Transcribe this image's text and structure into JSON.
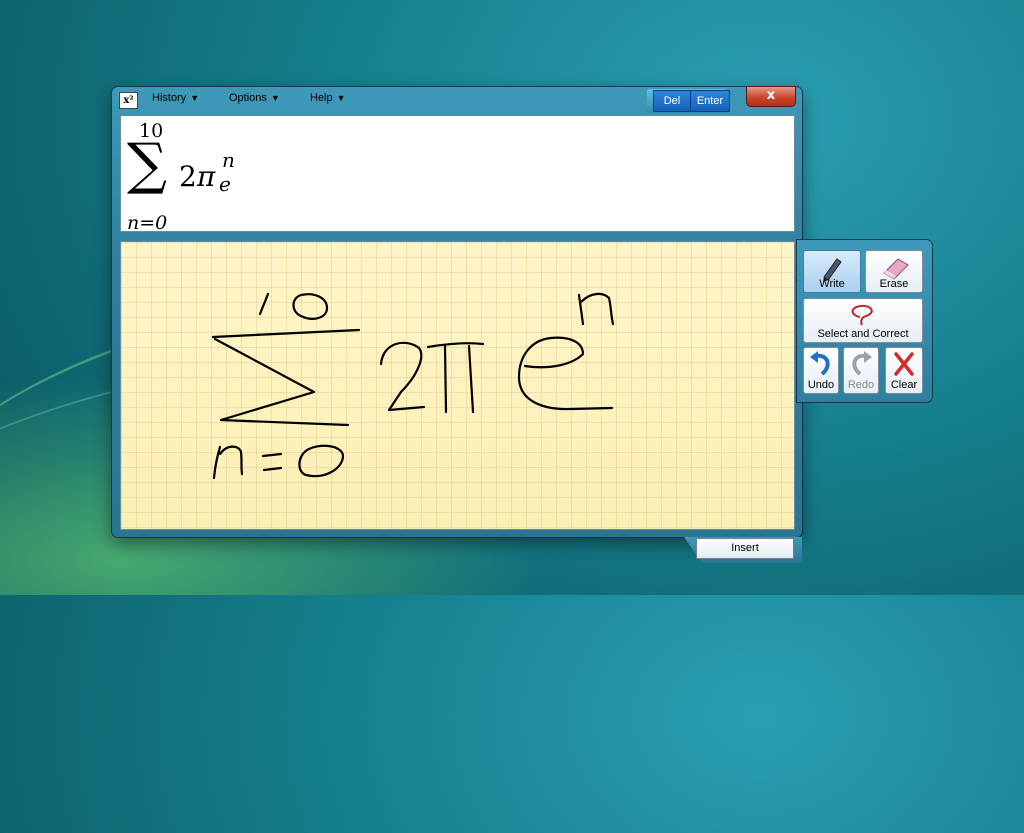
{
  "window": {
    "app_icon": "x²",
    "menu": [
      {
        "label": "History"
      },
      {
        "label": "Options"
      },
      {
        "label": "Help"
      }
    ],
    "del_label": "Del",
    "enter_label": "Enter",
    "close_label": "x"
  },
  "preview": {
    "sum_upper": "10",
    "sum_symbol": "∑",
    "sum_lower": "n=0",
    "term_coef": "2",
    "term_pi": "π",
    "term_sup": "n",
    "term_sub": "e"
  },
  "tools": {
    "write": "Write",
    "erase": "Erase",
    "select_correct": "Select and Correct",
    "undo": "Undo",
    "redo": "Redo",
    "clear": "Clear"
  },
  "insert_label": "Insert",
  "icons": {
    "write": "pen-icon",
    "erase": "eraser-icon",
    "select": "lasso-icon",
    "undo": "undo-icon",
    "redo": "redo-icon",
    "clear": "clear-x-icon"
  }
}
